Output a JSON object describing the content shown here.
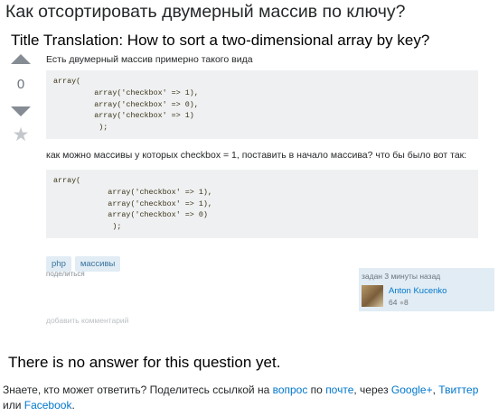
{
  "question": {
    "title": "Как отсортировать двумерный массив по ключу?",
    "vote_count": "0",
    "text1": "Есть двумерный массив примерно такого вида",
    "code1": "array(\n         array('checkbox' => 1),\n         array('checkbox' => 0),\n         array('checkbox' => 1)\n          );",
    "text2": "как можно массивы у которых checkbox = 1, поставить в начало массива? что бы было вот так:",
    "code2": "array(\n            array('checkbox' => 1),\n            array('checkbox' => 1),\n            array('checkbox' => 0)\n             );",
    "tags": [
      "php",
      "массивы"
    ],
    "share_label": "поделиться",
    "add_comment_label": "добавить комментарий",
    "owner": {
      "asked_text": "задан 3 минуты назад",
      "name": "Anton Kucenko",
      "reputation": "64",
      "badge_count": "8"
    }
  },
  "annotations": {
    "title_translation": "Title Translation: How to sort a two-dimensional array by key?",
    "no_answer": "There is no answer for this question yet."
  },
  "footer": {
    "t1": "Знаете, кто может ответить? Поделитесь ссылкой на ",
    "link_question": "вопрос",
    "t2": " по ",
    "link_mail": "почте",
    "t3": ", через ",
    "link_google": "Google+",
    "t4": ", ",
    "link_twitter": "Твиттер",
    "t5": " или ",
    "link_facebook": "Facebook",
    "t6": "."
  },
  "colors": {
    "link": "#0077cc",
    "tag_bg": "#e1ecf4",
    "code_bg": "#eff0f1"
  },
  "icons": {
    "up": "arrow-up-icon",
    "down": "arrow-down-icon",
    "star": "star-icon"
  }
}
